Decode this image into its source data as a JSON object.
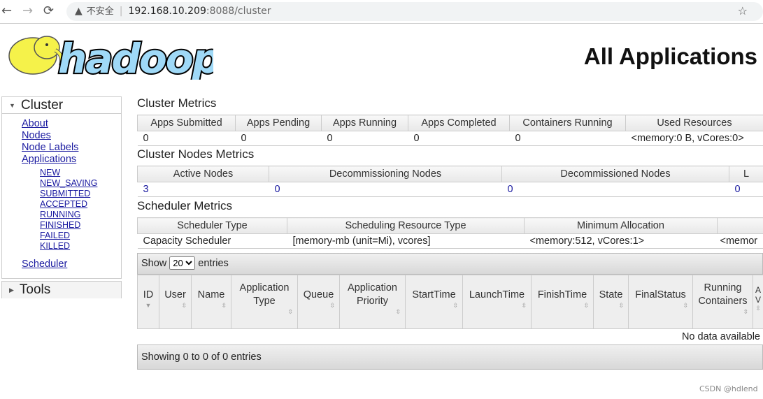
{
  "browser": {
    "warning": "不安全",
    "url_host": "192.168.10.209",
    "url_path": ":8088/cluster",
    "back": "←",
    "forward": "→",
    "reload": "⟳",
    "star": "☆"
  },
  "logo": {
    "text": "hadoop",
    "colors": {
      "elephant": "#f5f24a",
      "text": "#9fd9f7"
    }
  },
  "page_title": "All Applications",
  "sidebar": {
    "cluster": {
      "label": "Cluster",
      "items": [
        "About",
        "Nodes",
        "Node Labels",
        "Applications"
      ],
      "sub_items": [
        "NEW",
        "NEW_SAVING",
        "SUBMITTED",
        "ACCEPTED",
        "RUNNING",
        "FINISHED",
        "FAILED",
        "KILLED"
      ],
      "scheduler": "Scheduler"
    },
    "tools": {
      "label": "Tools"
    }
  },
  "cluster_metrics": {
    "title": "Cluster Metrics",
    "headers": [
      "Apps Submitted",
      "Apps Pending",
      "Apps Running",
      "Apps Completed",
      "Containers Running",
      "Used Resources"
    ],
    "values": [
      "0",
      "0",
      "0",
      "0",
      "0",
      "<memory:0 B, vCores:0>"
    ]
  },
  "nodes_metrics": {
    "title": "Cluster Nodes Metrics",
    "headers": [
      "Active Nodes",
      "Decommissioning Nodes",
      "Decommissioned Nodes",
      "L"
    ],
    "values": [
      "3",
      "0",
      "0",
      "0"
    ]
  },
  "scheduler_metrics": {
    "title": "Scheduler Metrics",
    "headers": [
      "Scheduler Type",
      "Scheduling Resource Type",
      "Minimum Allocation",
      ""
    ],
    "values": [
      "Capacity Scheduler",
      "[memory-mb (unit=Mi), vcores]",
      "<memory:512, vCores:1>",
      "<memor"
    ]
  },
  "apps": {
    "show_label": "Show",
    "page_size": "20",
    "entries_label": "entries",
    "headers": [
      "ID",
      "User",
      "Name",
      "Application Type",
      "Queue",
      "Application Priority",
      "StartTime",
      "LaunchTime",
      "FinishTime",
      "State",
      "FinalStatus",
      "Running Containers",
      "A V"
    ],
    "empty": "No data available",
    "footer": "Showing 0 to 0 of 0 entries"
  },
  "watermark": "CSDN @hdlend"
}
